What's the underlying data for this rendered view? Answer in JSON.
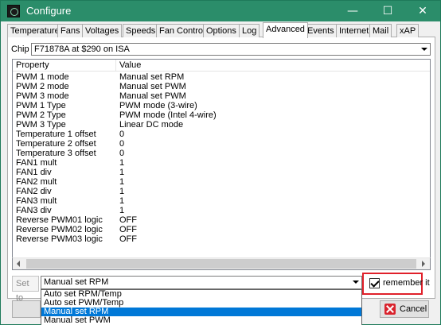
{
  "window": {
    "title": "Configure",
    "minimize_glyph": "—",
    "maximize_glyph": "☐",
    "close_glyph": "✕",
    "accent_color": "#2b8d6a"
  },
  "tabs": [
    {
      "label": "Temperatures"
    },
    {
      "label": "Fans"
    },
    {
      "label": "Voltages"
    },
    {
      "label": "Speeds"
    },
    {
      "label": "Fan Control"
    },
    {
      "label": "Options"
    },
    {
      "label": "Log"
    },
    {
      "label": "Advanced",
      "active": true
    },
    {
      "label": "Events"
    },
    {
      "label": "Internet"
    },
    {
      "label": "Mail"
    },
    {
      "label": "xAP"
    }
  ],
  "chip": {
    "label": "Chip",
    "value": "F71878A at $290 on ISA"
  },
  "properties": {
    "header_property": "Property",
    "header_value": "Value",
    "rows": [
      {
        "property": "PWM 1 mode",
        "value": "Manual set RPM"
      },
      {
        "property": "PWM 2 mode",
        "value": "Manual set PWM"
      },
      {
        "property": "PWM 3 mode",
        "value": "Manual set PWM"
      },
      {
        "property": "PWM 1 Type",
        "value": "PWM mode (3-wire)"
      },
      {
        "property": "PWM 2 Type",
        "value": "PWM mode (Intel 4-wire)"
      },
      {
        "property": "PWM 3 Type",
        "value": "Linear DC mode"
      },
      {
        "property": "Temperature 1 offset",
        "value": "0"
      },
      {
        "property": "Temperature 2 offset",
        "value": "0"
      },
      {
        "property": "Temperature 3 offset",
        "value": "0"
      },
      {
        "property": "FAN1 mult",
        "value": "1"
      },
      {
        "property": "FAN1 div",
        "value": "1"
      },
      {
        "property": "FAN2 mult",
        "value": "1"
      },
      {
        "property": "FAN2 div",
        "value": "1"
      },
      {
        "property": "FAN3 mult",
        "value": "1"
      },
      {
        "property": "FAN3 div",
        "value": "1"
      },
      {
        "property": "Reverse PWM01 logic",
        "value": "OFF"
      },
      {
        "property": "Reverse PWM02 logic",
        "value": "OFF"
      },
      {
        "property": "Reverse PWM03 logic",
        "value": "OFF"
      }
    ]
  },
  "set_to": {
    "label": "Set to",
    "value": "Manual set RPM",
    "options": [
      {
        "label": "Auto set RPM/Temp",
        "selected": false
      },
      {
        "label": "Auto set PWM/Temp",
        "selected": false
      },
      {
        "label": "Manual set RPM",
        "selected": true
      },
      {
        "label": "Manual set PWM",
        "selected": false
      }
    ]
  },
  "remember": {
    "label": "remember it",
    "checked": true,
    "highlight_color": "#e0202a"
  },
  "buttons": {
    "cancel_label": "Cancel"
  }
}
